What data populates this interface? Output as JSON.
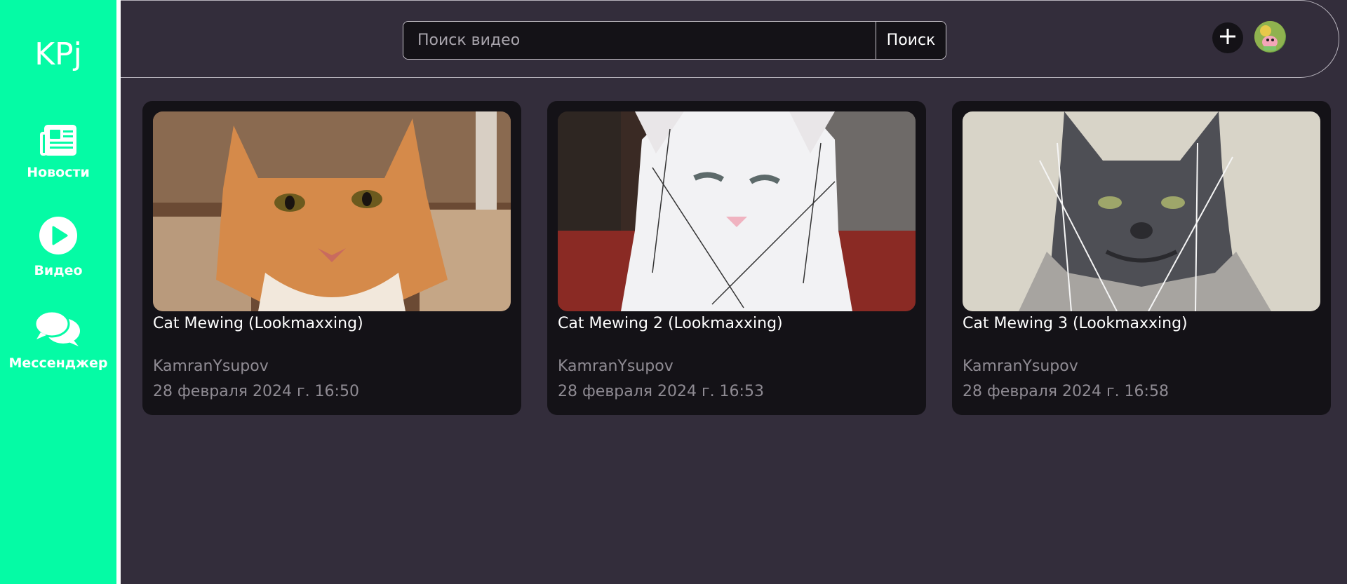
{
  "sidebar": {
    "logo": "KPj",
    "items": [
      {
        "label": "Новости",
        "icon": "newspaper-icon"
      },
      {
        "label": "Видео",
        "icon": "play-circle-icon"
      },
      {
        "label": "Мессенджер",
        "icon": "chat-bubbles-icon"
      }
    ]
  },
  "header": {
    "search_placeholder": "Поиск видео",
    "search_button": "Поиск",
    "add_icon": "plus-icon",
    "avatar_icon": "user-avatar"
  },
  "videos": [
    {
      "title": "Cat Mewing (Lookmaxxing)",
      "author": "KamranYsupov",
      "date": "28 февраля 2024 г. 16:50",
      "thumbnail": "orange-cat"
    },
    {
      "title": "Cat Mewing 2 (Lookmaxxing)",
      "author": "KamranYsupov",
      "date": "28 февраля 2024 г. 16:53",
      "thumbnail": "white-cat"
    },
    {
      "title": "Cat Mewing 3 (Lookmaxxing)",
      "author": "KamranYsupov",
      "date": "28 февраля 2024 г. 16:58",
      "thumbnail": "grey-maine-coon"
    }
  ],
  "colors": {
    "accent": "#05fba5",
    "background": "#332d3b",
    "card": "#141217",
    "muted_text": "#8f8b93"
  }
}
